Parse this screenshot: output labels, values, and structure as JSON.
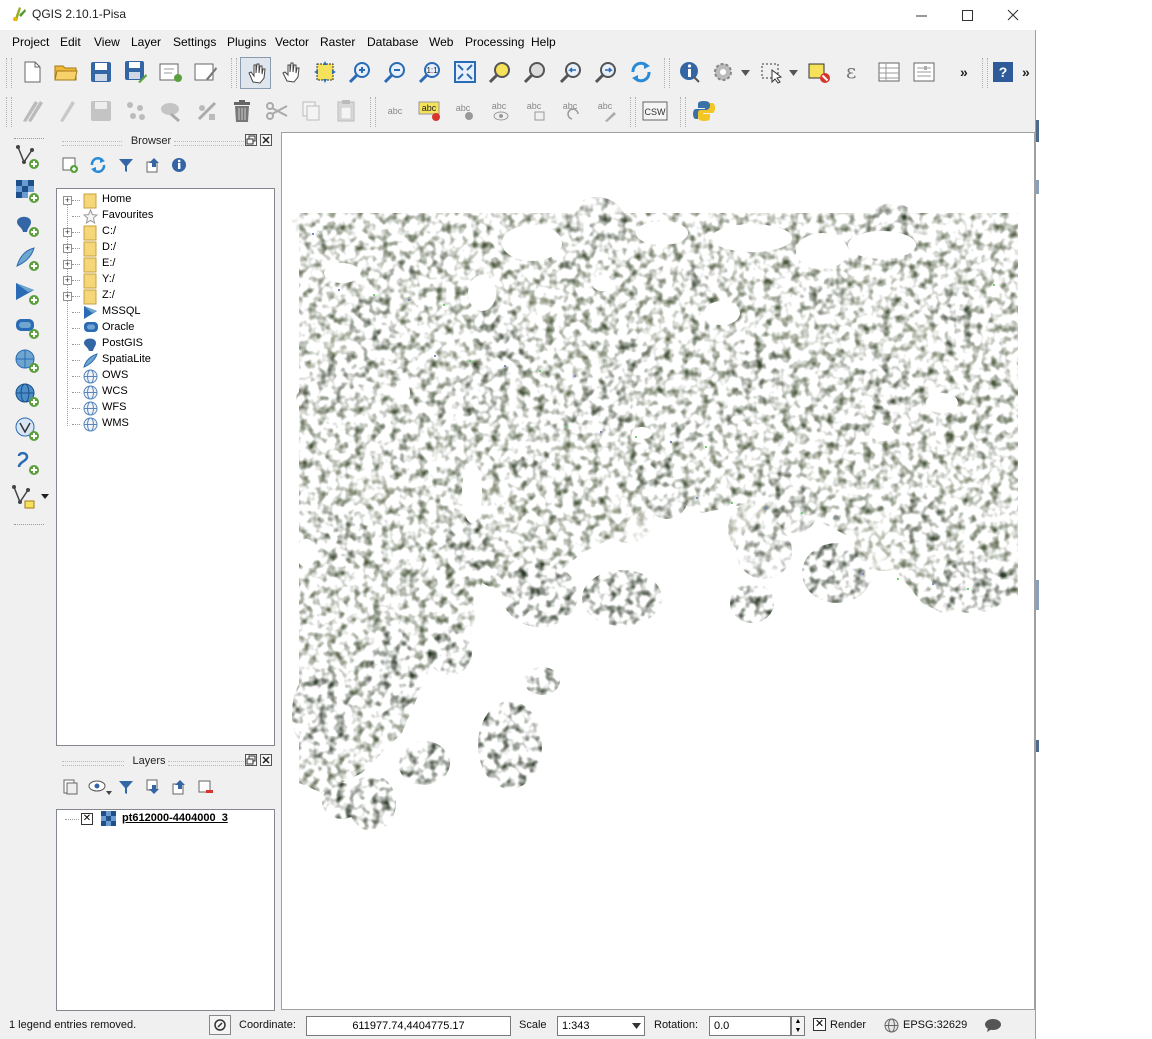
{
  "window": {
    "title": "QGIS 2.10.1-Pisa"
  },
  "menubar": [
    "Project",
    "Edit",
    "View",
    "Layer",
    "Settings",
    "Plugins",
    "Vector",
    "Raster",
    "Database",
    "Web",
    "Processing",
    "Help"
  ],
  "toolbars": {
    "more_label": "»",
    "label_tools": [
      "abc",
      "abc",
      "abc",
      "abc",
      "abc",
      "abc",
      "abc"
    ],
    "csw_label": "CSW"
  },
  "browser": {
    "title": "Browser",
    "items": [
      {
        "label": "Home",
        "icon": "folder-icon",
        "expandable": true
      },
      {
        "label": "Favourites",
        "icon": "star-icon",
        "expandable": false
      },
      {
        "label": "C:/",
        "icon": "folder-icon",
        "expandable": true
      },
      {
        "label": "D:/",
        "icon": "folder-icon",
        "expandable": true
      },
      {
        "label": "E:/",
        "icon": "folder-icon",
        "expandable": true
      },
      {
        "label": "Y:/",
        "icon": "folder-icon",
        "expandable": true
      },
      {
        "label": "Z:/",
        "icon": "folder-icon",
        "expandable": true
      },
      {
        "label": "MSSQL",
        "icon": "mssql-icon",
        "expandable": false
      },
      {
        "label": "Oracle",
        "icon": "oracle-icon",
        "expandable": false
      },
      {
        "label": "PostGIS",
        "icon": "postgis-icon",
        "expandable": false
      },
      {
        "label": "SpatiaLite",
        "icon": "spatialite-icon",
        "expandable": false
      },
      {
        "label": "OWS",
        "icon": "globe-icon",
        "expandable": false
      },
      {
        "label": "WCS",
        "icon": "globe-icon",
        "expandable": false
      },
      {
        "label": "WFS",
        "icon": "globe-icon",
        "expandable": false
      },
      {
        "label": "WMS",
        "icon": "globe-icon",
        "expandable": false
      }
    ]
  },
  "layers": {
    "title": "Layers",
    "items": [
      {
        "label": "pt612000-4404000_3",
        "checked": true
      }
    ]
  },
  "statusbar": {
    "message": "1 legend entries removed.",
    "coordinate_label": "Coordinate:",
    "coordinate_value": "611977.74,4404775.17",
    "scale_label": "Scale",
    "scale_value": "1:343",
    "rotation_label": "Rotation:",
    "rotation_value": "0.0",
    "render_label": "Render",
    "render_checked": true,
    "crs_label": "EPSG:32629"
  },
  "colors": {
    "vegetation_dark": "#2f3b2a",
    "vegetation_mid": "#4d5a3f",
    "vegetation_light": "#6b7559",
    "folder": "#f5d77a",
    "accent_blue": "#2a6bb5"
  }
}
